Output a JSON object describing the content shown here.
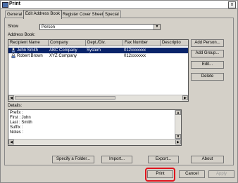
{
  "window": {
    "title": "Print",
    "close_glyph": "x"
  },
  "tabs": [
    {
      "label": "General"
    },
    {
      "label": "Edit Address Book"
    },
    {
      "label": "Register Cover Sheet"
    },
    {
      "label": "Special"
    }
  ],
  "show": {
    "label": "Show",
    "value": "Person"
  },
  "address_book_label": "Address Book:",
  "columns": [
    "Recipient Name",
    "Company",
    "Dept./Div.",
    "Fax Number",
    "Descriptio"
  ],
  "rows": [
    {
      "name": "John Smith",
      "company": "ABC Company",
      "dept": "System",
      "fax": "012xxxxxxx",
      "selected": true
    },
    {
      "name": "Robert Brown",
      "company": "XYZ Company",
      "dept": "",
      "fax": "012xxxxxxx",
      "selected": false
    }
  ],
  "side_buttons": {
    "add_person": "Add Person...",
    "add_group": "Add Group...",
    "edit": "Edit...",
    "delete": "Delete"
  },
  "details": {
    "label": "Details:",
    "lines": [
      "Prefix :",
      "First   : John",
      "Last    : Smith",
      "Suffix :",
      "Notes :"
    ]
  },
  "bottom_buttons": {
    "specify_folder": "Specify a Folder...",
    "import": "Import...",
    "export": "Export...",
    "about": "About"
  },
  "dialog_buttons": {
    "print": "Print",
    "cancel": "Cancel",
    "apply": "Apply"
  },
  "colors": {
    "selection": "#0a246a",
    "highlight": "#e0141e",
    "face": "#d4d0c8"
  }
}
